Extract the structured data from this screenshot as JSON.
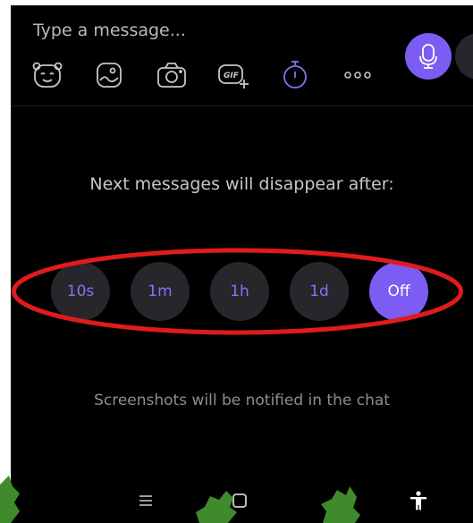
{
  "composer": {
    "placeholder": "Type a message...",
    "icons": [
      "sticker-face-icon",
      "photo-icon",
      "camera-icon",
      "gif-icon",
      "timer-icon",
      "more-icon"
    ],
    "active_icon": "timer-icon",
    "mic_icon": "microphone-icon"
  },
  "disappearing": {
    "heading": "Next messages will disappear after:",
    "options": [
      "10s",
      "1m",
      "1h",
      "1d",
      "Off"
    ],
    "selected": "Off",
    "note": "Screenshots will be notified in the chat"
  },
  "navbar": {
    "buttons": [
      "menu-icon",
      "home-icon",
      "accessibility-icon"
    ]
  },
  "colors": {
    "background": "#000000",
    "accent": "#7c5cf2",
    "option_bg": "#26262b",
    "option_text": "#8f6df8",
    "highlight": "#e01b1b",
    "decoration": "#3f8a2d"
  }
}
